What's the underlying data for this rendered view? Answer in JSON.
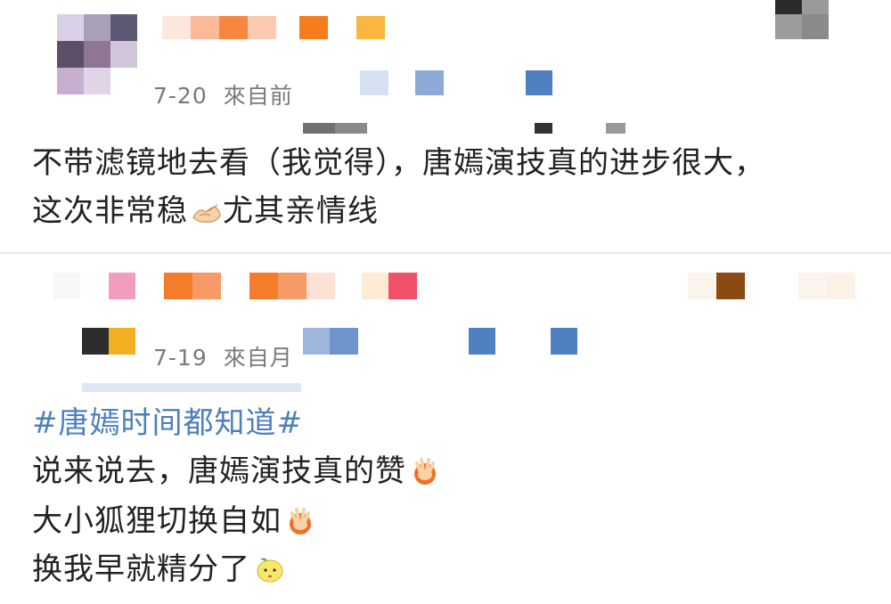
{
  "posts": [
    {
      "date": "7-20",
      "source": "來自前",
      "lines": [
        "不带滤镜地去看（我觉得），唐嫣演技真的进步很大，",
        "这次非常稳"
      ],
      "line2_tail": "尤其亲情线",
      "emojis": [
        "pointing-hands-emoji"
      ]
    },
    {
      "date": "7-19",
      "source": "來自月",
      "hashtag": "#唐嫣时间都知道#",
      "lines": [
        "说来说去，唐嫣演技真的赞",
        "大小狐狸切换自如",
        "换我早就精分了"
      ],
      "emojis": [
        "clapping-hands-emoji",
        "clapping-hands-emoji",
        "lemon-face-emoji"
      ]
    }
  ],
  "colors": {
    "text": "#222222",
    "meta": "#7a7a7a",
    "hashtag": "#4d7fbf",
    "divider": "#e6e6e6"
  }
}
